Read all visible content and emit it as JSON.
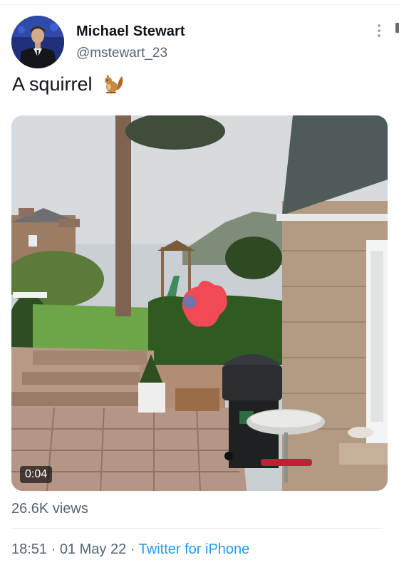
{
  "tweet": {
    "author_name": "Michael Stewart",
    "author_handle": "@mstewart_23",
    "text": "A squirrel",
    "emoji_icon": "squirrel-emoji",
    "more_icon": "more-vertical-icon"
  },
  "media": {
    "type": "video",
    "duration": "0:04"
  },
  "stats": {
    "views": "26.6K views"
  },
  "meta": {
    "time": "18:51",
    "separator": " · ",
    "date": "01 May 22",
    "source": "Twitter for iPhone"
  },
  "colors": {
    "secondary_text": "#536471",
    "link": "#1d9bf0",
    "primary_text": "#0f1419"
  }
}
